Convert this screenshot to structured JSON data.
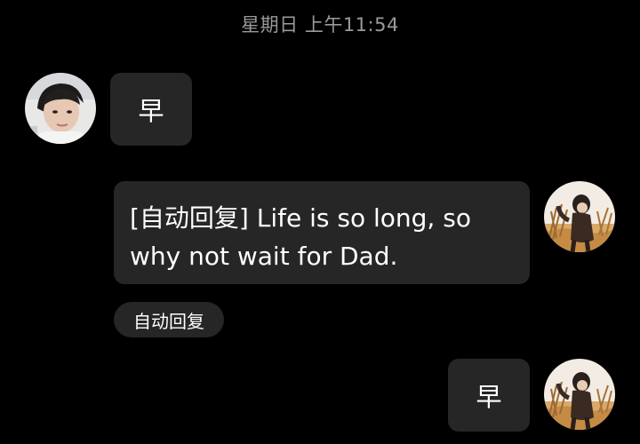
{
  "timestamp": "星期日 上午11:54",
  "messages": [
    {
      "side": "left",
      "text": "早",
      "avatar_icon": "contact-avatar-icon"
    },
    {
      "side": "right",
      "text": "[自动回复] Life is so long, so why not wait for Dad.",
      "tag": "自动回复",
      "avatar_icon": "self-avatar-icon"
    },
    {
      "side": "right",
      "text": "早",
      "avatar_icon": "self-avatar-icon"
    }
  ],
  "colors": {
    "background": "#000000",
    "bubble": "#262626",
    "timestamp_text": "#9a9a9a",
    "text": "#ffffff"
  }
}
